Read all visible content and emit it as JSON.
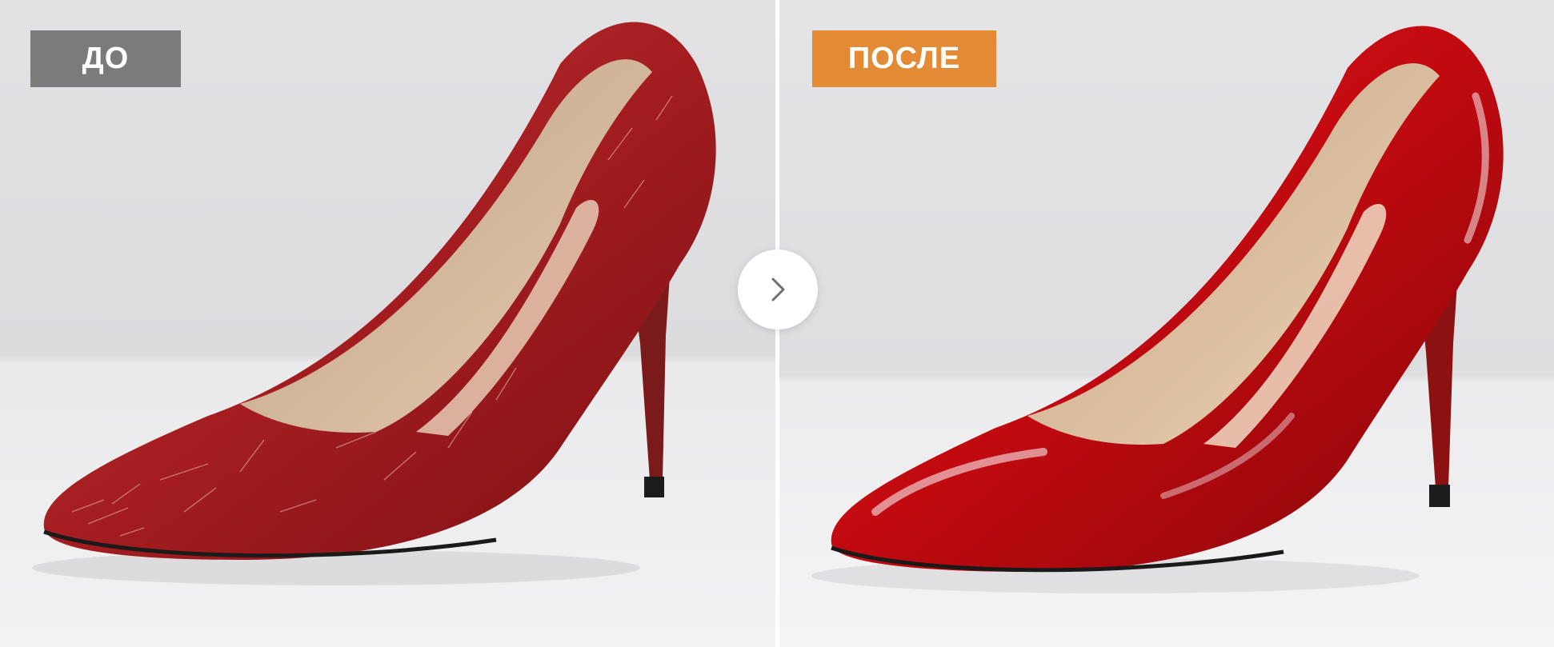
{
  "labels": {
    "before": "ДО",
    "after": "ПОСЛЕ"
  },
  "colors": {
    "before_badge": "#7b7b7b",
    "after_badge": "#e38a34",
    "divider": "#ffffff",
    "background": "#e6e6e8",
    "shoe_red_worn": "#a81c1e",
    "shoe_red_glossy": "#c80a10",
    "lining": "#cfae8c"
  },
  "icons": {
    "compare": "chevron-right-icon"
  }
}
